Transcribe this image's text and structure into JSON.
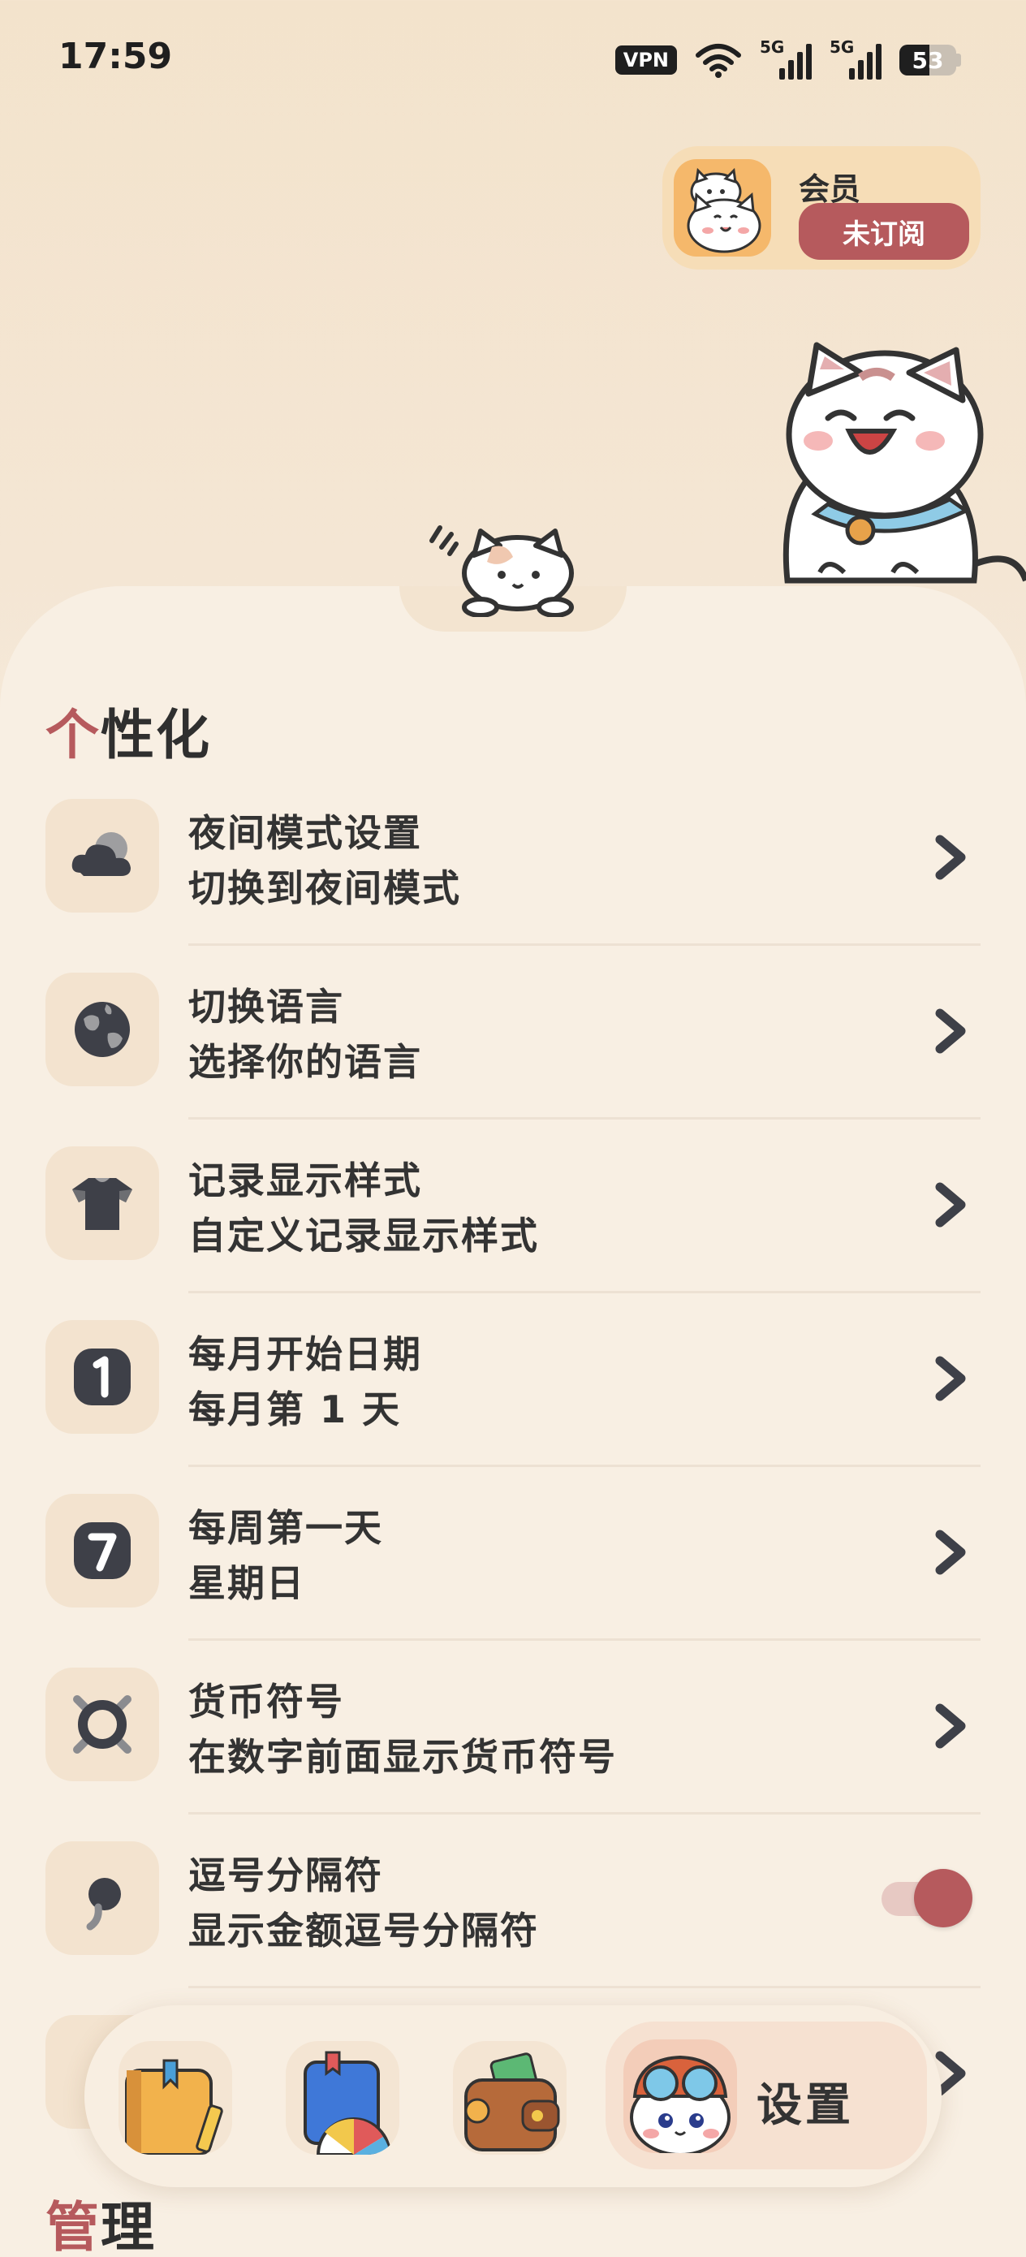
{
  "status_bar": {
    "time": "17:59",
    "vpn": "VPN",
    "network_1": "5G",
    "network_2": "5G",
    "battery": "53",
    "battery_level_percent": 53
  },
  "member": {
    "title": "会员",
    "button": "未订阅"
  },
  "personalization": {
    "title_accent": "个",
    "title_rest": "性化",
    "items": [
      {
        "title": "夜间模式设置",
        "subtitle": "切换到夜间模式",
        "icon": "moon-cloud-icon",
        "control": "chevron"
      },
      {
        "title": "切换语言",
        "subtitle": "选择你的语言",
        "icon": "globe-icon",
        "control": "chevron"
      },
      {
        "title": "记录显示样式",
        "subtitle": "自定义记录显示样式",
        "icon": "shirt-icon",
        "control": "chevron"
      },
      {
        "title": "每月开始日期",
        "subtitle": "每月第 1 天",
        "icon": "calendar-one-icon",
        "control": "chevron"
      },
      {
        "title": "每周第一天",
        "subtitle": "星期日",
        "icon": "calendar-seven-icon",
        "control": "chevron"
      },
      {
        "title": "货币符号",
        "subtitle": "在数字前面显示货币符号",
        "icon": "currency-icon",
        "control": "chevron"
      },
      {
        "title": "逗号分隔符",
        "subtitle": "显示金额逗号分隔符",
        "icon": "comma-icon",
        "control": "toggle",
        "toggle_on": true
      }
    ]
  },
  "management": {
    "title_accent": "管",
    "title_rest": "理"
  },
  "bottom_nav": {
    "items": [
      {
        "icon": "notebook-icon"
      },
      {
        "icon": "stats-book-icon"
      },
      {
        "icon": "wallet-icon"
      }
    ],
    "active": {
      "icon": "cat-pilot-icon",
      "label": "设置"
    }
  },
  "colors": {
    "accent": "#b65a5d",
    "background": "#f8efe3",
    "text": "#333333"
  }
}
